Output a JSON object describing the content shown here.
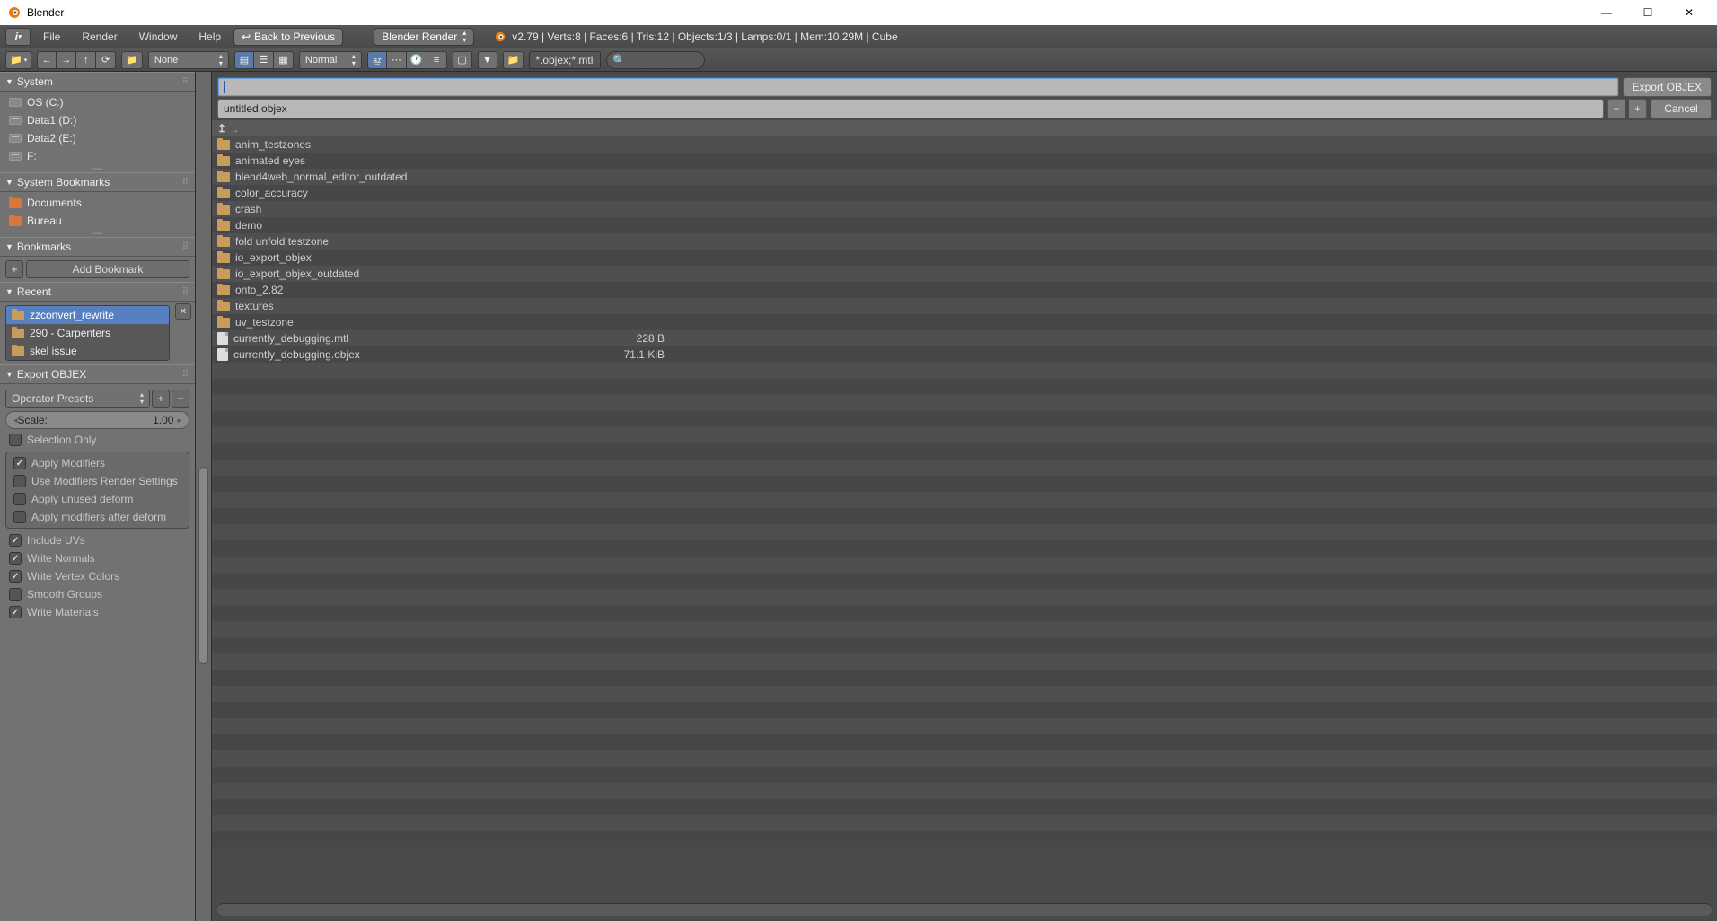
{
  "titlebar": {
    "app_name": "Blender"
  },
  "topmenu": {
    "file": "File",
    "render": "Render",
    "window": "Window",
    "help": "Help",
    "back_to_previous": "Back to Previous",
    "render_engine": "Blender Render",
    "status": "v2.79 | Verts:8 | Faces:6 | Tris:12 | Objects:1/3 | Lamps:0/1 | Mem:10.29M | Cube"
  },
  "toolbar": {
    "left1_none": "None",
    "display_mode": "Normal",
    "sort_az": "a͢z",
    "filter_pattern": "*.objex;*.mtl"
  },
  "filebrowser": {
    "current_path": "",
    "filename": "untitled.objex",
    "export_btn": "Export OBJEX",
    "cancel_btn": "Cancel",
    "parent_dir": "..",
    "entries": [
      {
        "type": "dir",
        "name": "anim_testzones",
        "size": ""
      },
      {
        "type": "dir",
        "name": "animated eyes",
        "size": ""
      },
      {
        "type": "dir",
        "name": "blend4web_normal_editor_outdated",
        "size": ""
      },
      {
        "type": "dir",
        "name": "color_accuracy",
        "size": ""
      },
      {
        "type": "dir",
        "name": "crash",
        "size": ""
      },
      {
        "type": "dir",
        "name": "demo",
        "size": ""
      },
      {
        "type": "dir",
        "name": "fold unfold testzone",
        "size": ""
      },
      {
        "type": "dir",
        "name": "io_export_objex",
        "size": ""
      },
      {
        "type": "dir",
        "name": "io_export_objex_outdated",
        "size": ""
      },
      {
        "type": "dir",
        "name": "onto_2.82",
        "size": ""
      },
      {
        "type": "dir",
        "name": "textures",
        "size": ""
      },
      {
        "type": "dir",
        "name": "uv_testzone",
        "size": ""
      },
      {
        "type": "file",
        "name": "currently_debugging.mtl",
        "size": "228 B"
      },
      {
        "type": "file",
        "name": "currently_debugging.objex",
        "size": "71.1 KiB"
      }
    ]
  },
  "sidebar": {
    "system": {
      "title": "System",
      "drives": [
        {
          "label": "OS (C:)"
        },
        {
          "label": "Data1 (D:)"
        },
        {
          "label": "Data2 (E:)"
        },
        {
          "label": "F:"
        }
      ]
    },
    "system_bookmarks": {
      "title": "System Bookmarks",
      "items": [
        {
          "label": "Documents"
        },
        {
          "label": "Bureau"
        }
      ]
    },
    "bookmarks": {
      "title": "Bookmarks",
      "add_btn": "Add Bookmark"
    },
    "recent": {
      "title": "Recent",
      "items": [
        {
          "label": "zzconvert_rewrite",
          "selected": true
        },
        {
          "label": "290 - Carpenters",
          "selected": false
        },
        {
          "label": "skel issue",
          "selected": false
        }
      ]
    },
    "export": {
      "title": "Export OBJEX",
      "preset_label": "Operator Presets",
      "scale_label": "Scale:",
      "scale_value": "1.00",
      "selection_only": "Selection Only",
      "apply_modifiers": "Apply Modifiers",
      "use_mrs": "Use Modifiers Render Settings",
      "apply_unused": "Apply unused deform",
      "apply_after": "Apply modifiers after deform",
      "include_uvs": "Include UVs",
      "write_normals": "Write Normals",
      "write_vcol": "Write Vertex Colors",
      "smooth_groups": "Smooth Groups",
      "write_materials": "Write Materials"
    }
  }
}
